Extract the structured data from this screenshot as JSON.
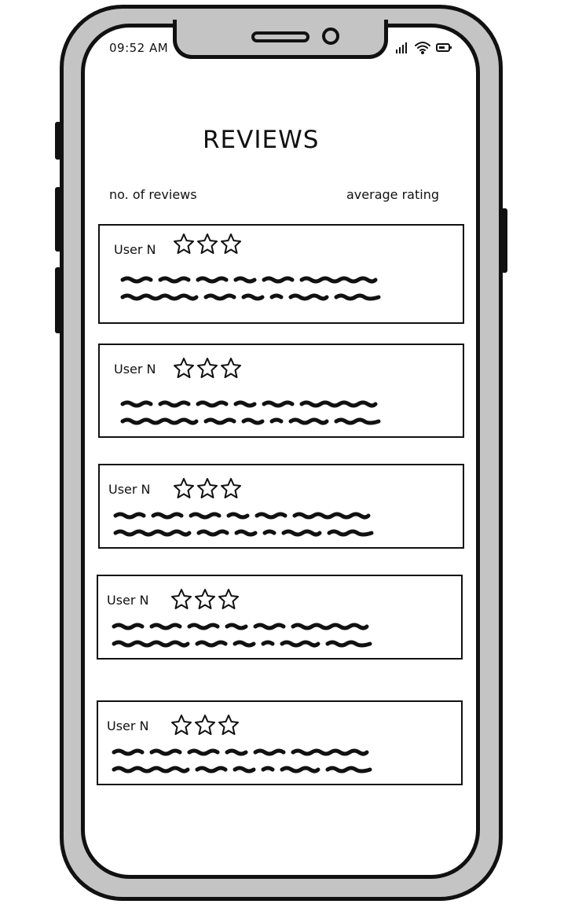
{
  "status_bar": {
    "time": "09:52 AM",
    "icons": [
      "signal-icon",
      "wifi-icon",
      "battery-icon"
    ]
  },
  "page": {
    "title": "REVIEWS",
    "stats": {
      "reviews_label": "no. of reviews",
      "rating_label": "average rating"
    }
  },
  "reviews": [
    {
      "user": "User N",
      "stars_shown": 3
    },
    {
      "user": "User N",
      "stars_shown": 3
    },
    {
      "user": "User N",
      "stars_shown": 3
    },
    {
      "user": "User N",
      "stars_shown": 3
    },
    {
      "user": "User N",
      "stars_shown": 3
    }
  ],
  "colors": {
    "frame": "#c4c4c4",
    "ink": "#111111",
    "screen": "#ffffff"
  }
}
